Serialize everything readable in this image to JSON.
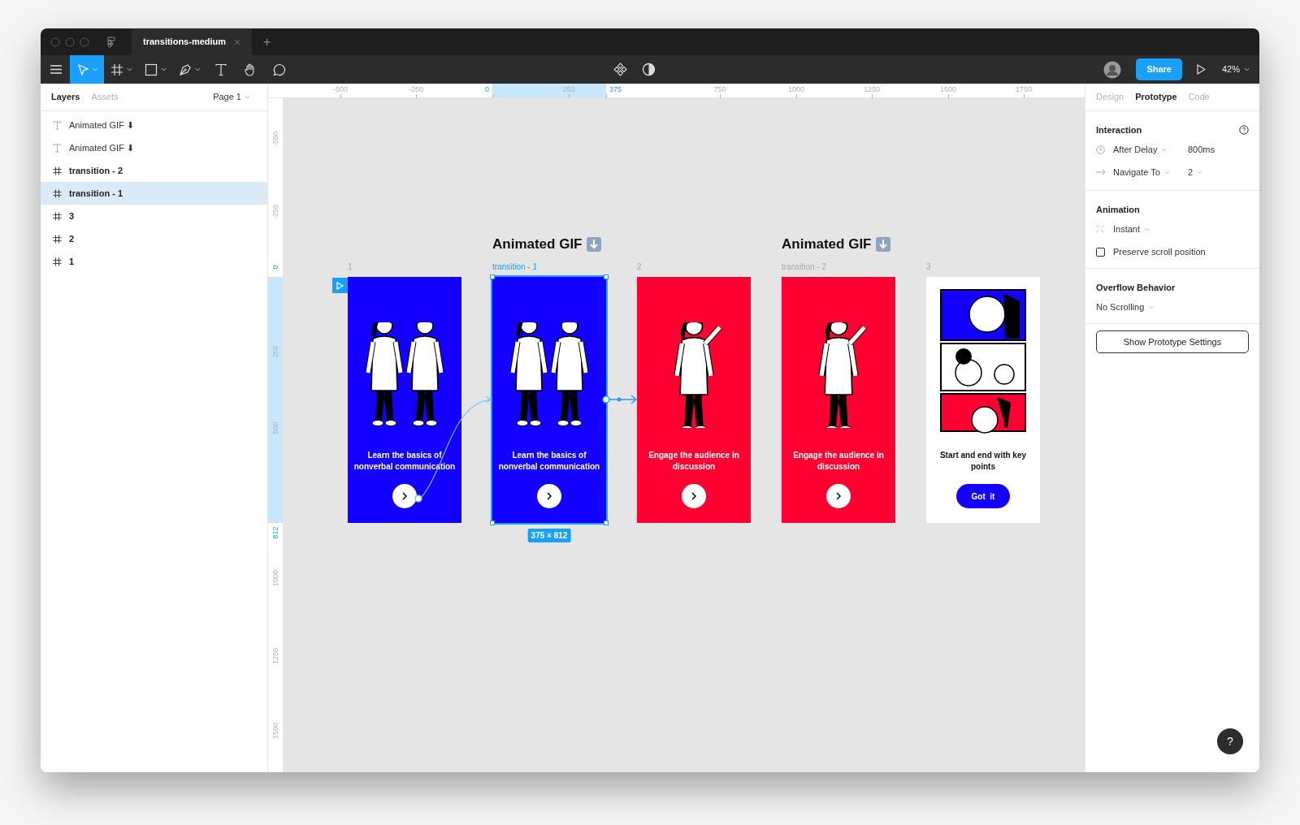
{
  "window": {
    "tab_title": "transitions-medium",
    "new_tab": "+"
  },
  "toolbar": {
    "tools": [
      {
        "kind": "move",
        "selected": true,
        "dropdown": true
      },
      {
        "kind": "frame",
        "selected": false,
        "dropdown": true
      },
      {
        "kind": "rect",
        "selected": false,
        "dropdown": true
      },
      {
        "kind": "pen",
        "selected": false,
        "dropdown": true
      },
      {
        "kind": "text",
        "selected": false,
        "dropdown": false
      },
      {
        "kind": "hand",
        "selected": false,
        "dropdown": false
      },
      {
        "kind": "comment",
        "selected": false,
        "dropdown": false
      }
    ],
    "share": "Share",
    "zoom": "42%"
  },
  "layers_panel": {
    "tabs": [
      {
        "label": "Layers",
        "selected": true
      },
      {
        "label": "Assets",
        "selected": false
      }
    ],
    "page": "Page 1",
    "layers": [
      {
        "kind": "text",
        "label": "Animated GIF ⬇",
        "selected": false
      },
      {
        "kind": "text",
        "label": "Animated GIF ⬇",
        "selected": false
      },
      {
        "kind": "frame",
        "label": "transition - 2",
        "selected": false
      },
      {
        "kind": "frame",
        "label": "transition - 1",
        "selected": true
      },
      {
        "kind": "frame",
        "label": "3",
        "selected": false
      },
      {
        "kind": "frame",
        "label": "2",
        "selected": false
      },
      {
        "kind": "frame",
        "label": "1",
        "selected": false
      }
    ]
  },
  "rulers": {
    "horizontal": [
      {
        "label": "-500",
        "highlight": false
      },
      {
        "label": "-250",
        "highlight": false
      },
      {
        "label": "0",
        "highlight": true
      },
      {
        "label": "250",
        "highlight": false
      },
      {
        "label": "375",
        "highlight": true
      },
      {
        "label": "750",
        "highlight": false
      },
      {
        "label": "1000",
        "highlight": false
      },
      {
        "label": "1250",
        "highlight": false
      },
      {
        "label": "1500",
        "highlight": false
      },
      {
        "label": "1750",
        "highlight": false
      }
    ],
    "vertical": [
      {
        "label": "-500",
        "highlight": false
      },
      {
        "label": "-250",
        "highlight": false
      },
      {
        "label": "0",
        "highlight": true
      },
      {
        "label": "250",
        "highlight": false
      },
      {
        "label": "500",
        "highlight": false
      },
      {
        "label": "812",
        "highlight": true
      },
      {
        "label": "1000",
        "highlight": false
      },
      {
        "label": "1250",
        "highlight": false
      },
      {
        "label": "1500",
        "highlight": false
      }
    ]
  },
  "canvas": {
    "titles": [
      "Animated GIF",
      "Animated GIF"
    ],
    "frames": [
      {
        "label": "1",
        "selected": false,
        "kind": "pair",
        "color": "#1400ff",
        "caption": "Learn the basics of nonverbal communication"
      },
      {
        "label": "transition - 1",
        "selected": true,
        "kind": "pair",
        "color": "#1400ff",
        "caption": "Learn the basics of nonverbal communication"
      },
      {
        "label": "2",
        "selected": false,
        "kind": "single",
        "color": "#ff0030",
        "caption": "Engage the audience in discussion"
      },
      {
        "label": "transition - 2",
        "selected": false,
        "kind": "single",
        "color": "#ff0030",
        "caption": "Engage the audience in discussion"
      },
      {
        "label": "3",
        "selected": false,
        "kind": "comic",
        "color": "#ffffff",
        "caption": "Start and end with key points",
        "button_label": "Got  it"
      }
    ],
    "size_badge": "375 × 812"
  },
  "prototype_panel": {
    "tabs": [
      {
        "label": "Design",
        "selected": false
      },
      {
        "label": "Prototype",
        "selected": true
      },
      {
        "label": "Code",
        "selected": false
      }
    ],
    "interaction": {
      "heading": "Interaction",
      "trigger": "After Delay",
      "delay": "800ms",
      "action": "Navigate To",
      "destination": "2"
    },
    "animation": {
      "heading": "Animation",
      "type": "Instant",
      "preserve_scroll": {
        "label": "Preserve scroll position",
        "checked": false
      }
    },
    "overflow": {
      "heading": "Overflow Behavior",
      "value": "No Scrolling"
    },
    "settings_button": "Show Prototype Settings",
    "help": "?"
  }
}
